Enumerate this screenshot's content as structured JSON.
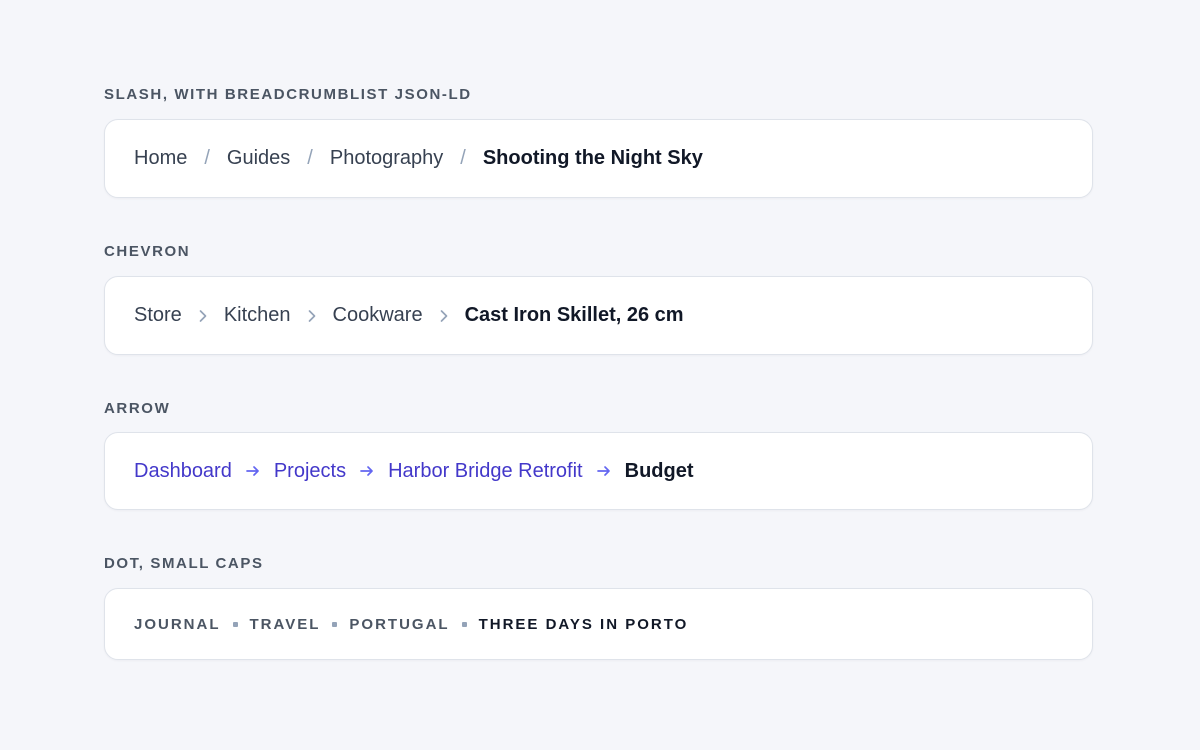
{
  "sections": [
    {
      "title": "SLASH, WITH BREADCRUMBLIST JSON-LD",
      "separator": "/",
      "items": [
        "Home",
        "Guides",
        "Photography"
      ],
      "current": "Shooting the Night Sky"
    },
    {
      "title": "CHEVRON",
      "separator_icon": "chevron-right-icon",
      "items": [
        "Store",
        "Kitchen",
        "Cookware"
      ],
      "current": "Cast Iron Skillet, 26 cm"
    },
    {
      "title": "ARROW",
      "separator_icon": "arrow-right-icon",
      "link_color": "#4338ca",
      "items": [
        "Dashboard",
        "Projects",
        "Harbor Bridge Retrofit"
      ],
      "current": "Budget"
    },
    {
      "title": "DOT, SMALL CAPS",
      "separator_icon": "dot-icon",
      "items": [
        "Journal",
        "Travel",
        "Portugal"
      ],
      "current": "Three Days in Porto"
    }
  ],
  "colors": {
    "background": "#f5f6fa",
    "card": "#ffffff",
    "separator": "#94a3b8",
    "current_text": "#111827"
  }
}
